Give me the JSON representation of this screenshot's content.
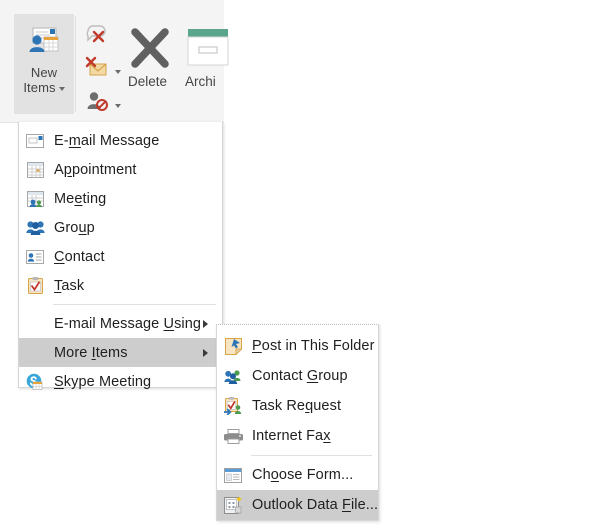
{
  "ribbon": {
    "new_items": {
      "line1": "New",
      "line2": "Items",
      "icon": "new-items-icon",
      "has_dropdown": true
    },
    "delete": {
      "label": "Delete",
      "icon": "delete-x-icon"
    },
    "archive": {
      "label": "Archi",
      "icon": "archive-icon"
    },
    "small_commands": [
      {
        "name": "ignore-conversation-icon",
        "label": ""
      },
      {
        "name": "junk-email-icon",
        "label": "",
        "has_dropdown": true
      },
      {
        "name": "block-sender-icon",
        "label": "",
        "has_dropdown": true
      }
    ]
  },
  "main_menu": {
    "items": [
      {
        "icon": "email-message-icon",
        "pre": "E-",
        "accel": "m",
        "post": "ail Message",
        "type": "item"
      },
      {
        "icon": "appointment-icon",
        "pre": "A",
        "accel": "p",
        "post": "pointment",
        "type": "item"
      },
      {
        "icon": "meeting-icon",
        "pre": "Me",
        "accel": "e",
        "post": "ting",
        "type": "item"
      },
      {
        "icon": "group-icon",
        "pre": "Gro",
        "accel": "u",
        "post": "p",
        "type": "item"
      },
      {
        "icon": "contact-icon",
        "pre": "",
        "accel": "C",
        "post": "ontact",
        "type": "item"
      },
      {
        "icon": "task-icon",
        "pre": "",
        "accel": "T",
        "post": "ask",
        "type": "item"
      },
      {
        "type": "separator"
      },
      {
        "icon": "",
        "pre": "E-mail Message ",
        "accel": "U",
        "post": "sing",
        "type": "submenu"
      },
      {
        "icon": "",
        "pre": "More ",
        "accel": "I",
        "post": "tems",
        "type": "submenu",
        "selected": true
      },
      {
        "icon": "skype-meeting-icon",
        "pre": "",
        "accel": "S",
        "post": "kype Meeting",
        "type": "item"
      }
    ]
  },
  "sub_menu": {
    "items": [
      {
        "icon": "post-in-folder-icon",
        "pre": "",
        "accel": "P",
        "post": "ost in This Folder",
        "type": "item"
      },
      {
        "icon": "contact-group-icon",
        "pre": "Contact ",
        "accel": "G",
        "post": "roup",
        "type": "item"
      },
      {
        "icon": "task-request-icon",
        "pre": "Task Re",
        "accel": "q",
        "post": "uest",
        "type": "item"
      },
      {
        "icon": "internet-fax-icon",
        "pre": "Internet Fa",
        "accel": "x",
        "post": "",
        "type": "item"
      },
      {
        "type": "separator"
      },
      {
        "icon": "choose-form-icon",
        "pre": "Ch",
        "accel": "o",
        "post": "ose Form...",
        "type": "item"
      },
      {
        "icon": "outlook-data-file-icon",
        "pre": "Outlook Data ",
        "accel": "F",
        "post": "ile...",
        "type": "item",
        "selected": true
      }
    ]
  },
  "colors": {
    "ribbon_bg": "#f4f4f4",
    "group_bg": "#e2e2e2",
    "menu_bg": "#ffffff",
    "menu_border": "#d6d6d6",
    "highlight": "#cdcdcd",
    "text": "#1f1f1f",
    "accent_blue": "#2e75b6",
    "accent_green": "#5ba58c",
    "accent_red": "#c0392b",
    "accent_orange": "#e8a33d"
  }
}
